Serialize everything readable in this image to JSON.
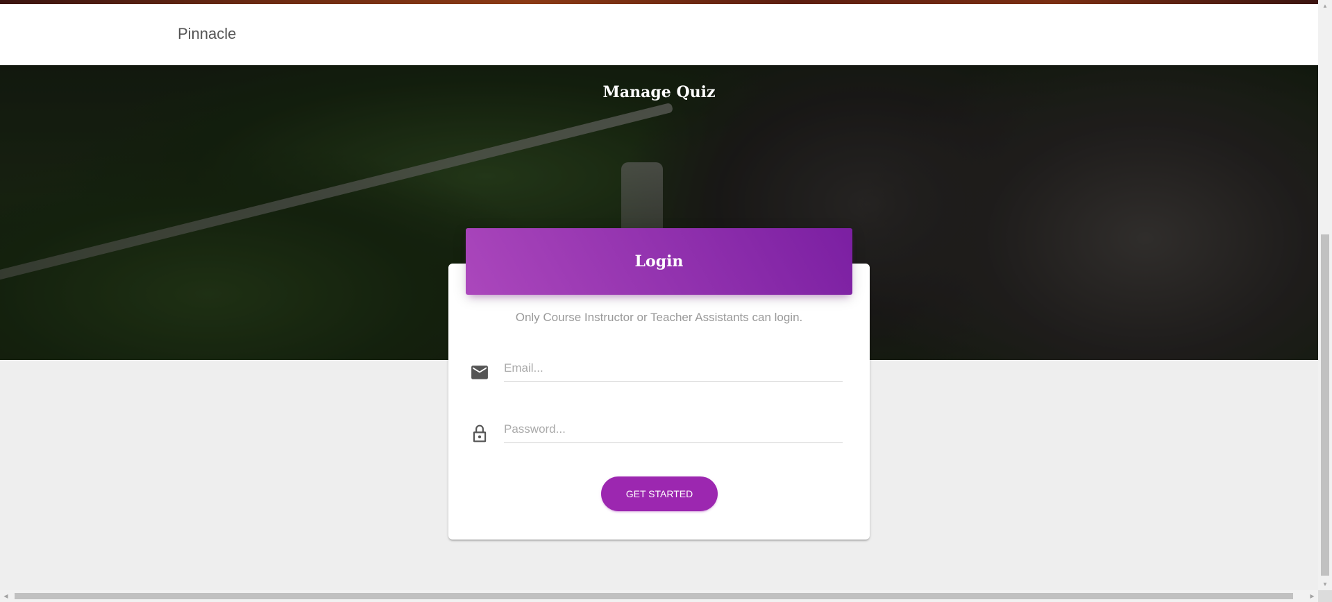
{
  "navbar": {
    "brand": "Pinnacle"
  },
  "hero": {
    "title": "Manage Quiz"
  },
  "login": {
    "header_title": "Login",
    "description": "Only Course Instructor or Teacher Assistants can login.",
    "email": {
      "placeholder": "Email...",
      "value": "",
      "icon": "mail-icon"
    },
    "password": {
      "placeholder": "Password...",
      "value": "",
      "icon": "lock-icon"
    },
    "submit_label": "GET STARTED"
  },
  "colors": {
    "accent": "#9c27b0",
    "header_gradient_start": "#ab47bc",
    "header_gradient_end": "#7b1fa2",
    "page_background": "#eeeeee"
  }
}
